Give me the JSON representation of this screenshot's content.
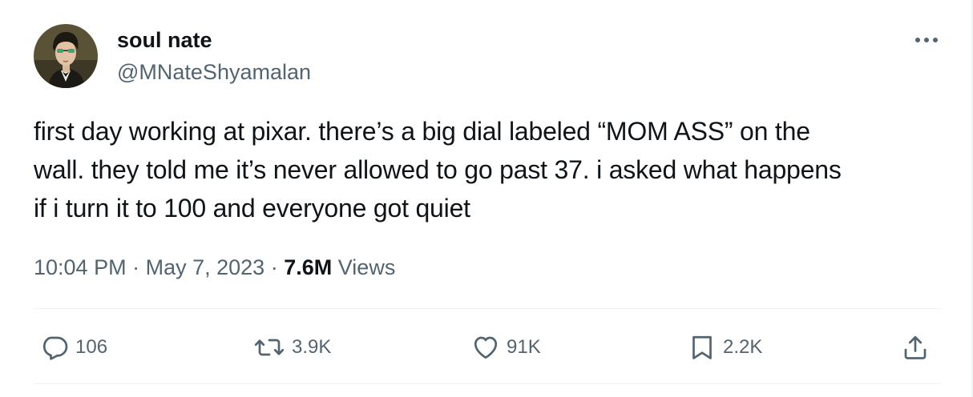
{
  "author": {
    "display_name": "soul nate",
    "handle": "@MNateShyamalan"
  },
  "tweet": {
    "text_lines": [
      "first day working at pixar. there’s a big dial labeled “MOM ASS” on the",
      "wall. they told me it’s never allowed to go past 37. i asked what happens",
      "if i turn it to 100 and everyone got quiet"
    ],
    "time": "10:04 PM",
    "separator": "·",
    "date": "May 7, 2023",
    "views_count": "7.6M",
    "views_label": "Views"
  },
  "actions": {
    "replies": "106",
    "retweets": "3.9K",
    "likes": "91K",
    "bookmarks": "2.2K"
  },
  "icons": {
    "more": "more-horizontal-icon",
    "reply": "reply-bubble-icon",
    "retweet": "retweet-icon",
    "like": "heart-icon",
    "bookmark": "bookmark-icon",
    "share": "share-upload-icon"
  },
  "colors": {
    "text_primary": "#0f1419",
    "text_secondary": "#536471",
    "divider": "#eff3f4"
  }
}
